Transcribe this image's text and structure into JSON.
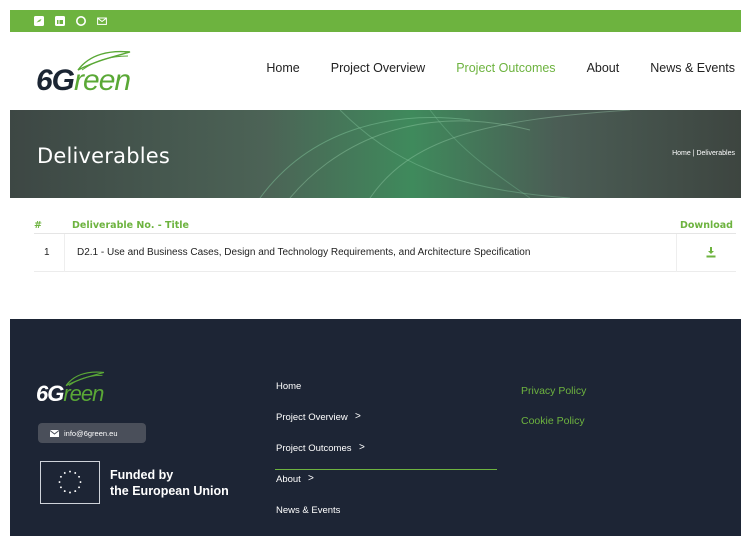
{
  "topbar": {
    "icons": [
      "twitter-icon",
      "linkedin-icon",
      "github-icon",
      "email-icon"
    ]
  },
  "logo": {
    "prefix": "6G",
    "suffix": "reen"
  },
  "nav": {
    "items": [
      {
        "label": "Home"
      },
      {
        "label": "Project Overview"
      },
      {
        "label": "Project Outcomes",
        "active": true
      },
      {
        "label": "About"
      },
      {
        "label": "News & Events"
      }
    ]
  },
  "banner": {
    "title": "Deliverables",
    "breadcrumb": "Home | Deliverables"
  },
  "table": {
    "headers": {
      "num": "#",
      "title": "Deliverable No. - Title",
      "download": "Download"
    },
    "rows": [
      {
        "num": "1",
        "title": "D2.1 - Use and Business Cases, Design and Technology Requirements, and Architecture Specification",
        "download_icon": "download-icon"
      }
    ]
  },
  "footer": {
    "email": "info@6green.eu",
    "eu_line1": "Funded by",
    "eu_line2": "the European Union",
    "nav": {
      "home": "Home",
      "overview": "Project Overview",
      "outcomes": "Project Outcomes",
      "about": "About",
      "news": "News & Events",
      "chevron": ">"
    },
    "privacy": "Privacy Policy",
    "cookie": "Cookie Policy"
  },
  "colors": {
    "accent": "#6db33f",
    "footer_bg": "#1d2535",
    "dark_text": "#222222"
  }
}
